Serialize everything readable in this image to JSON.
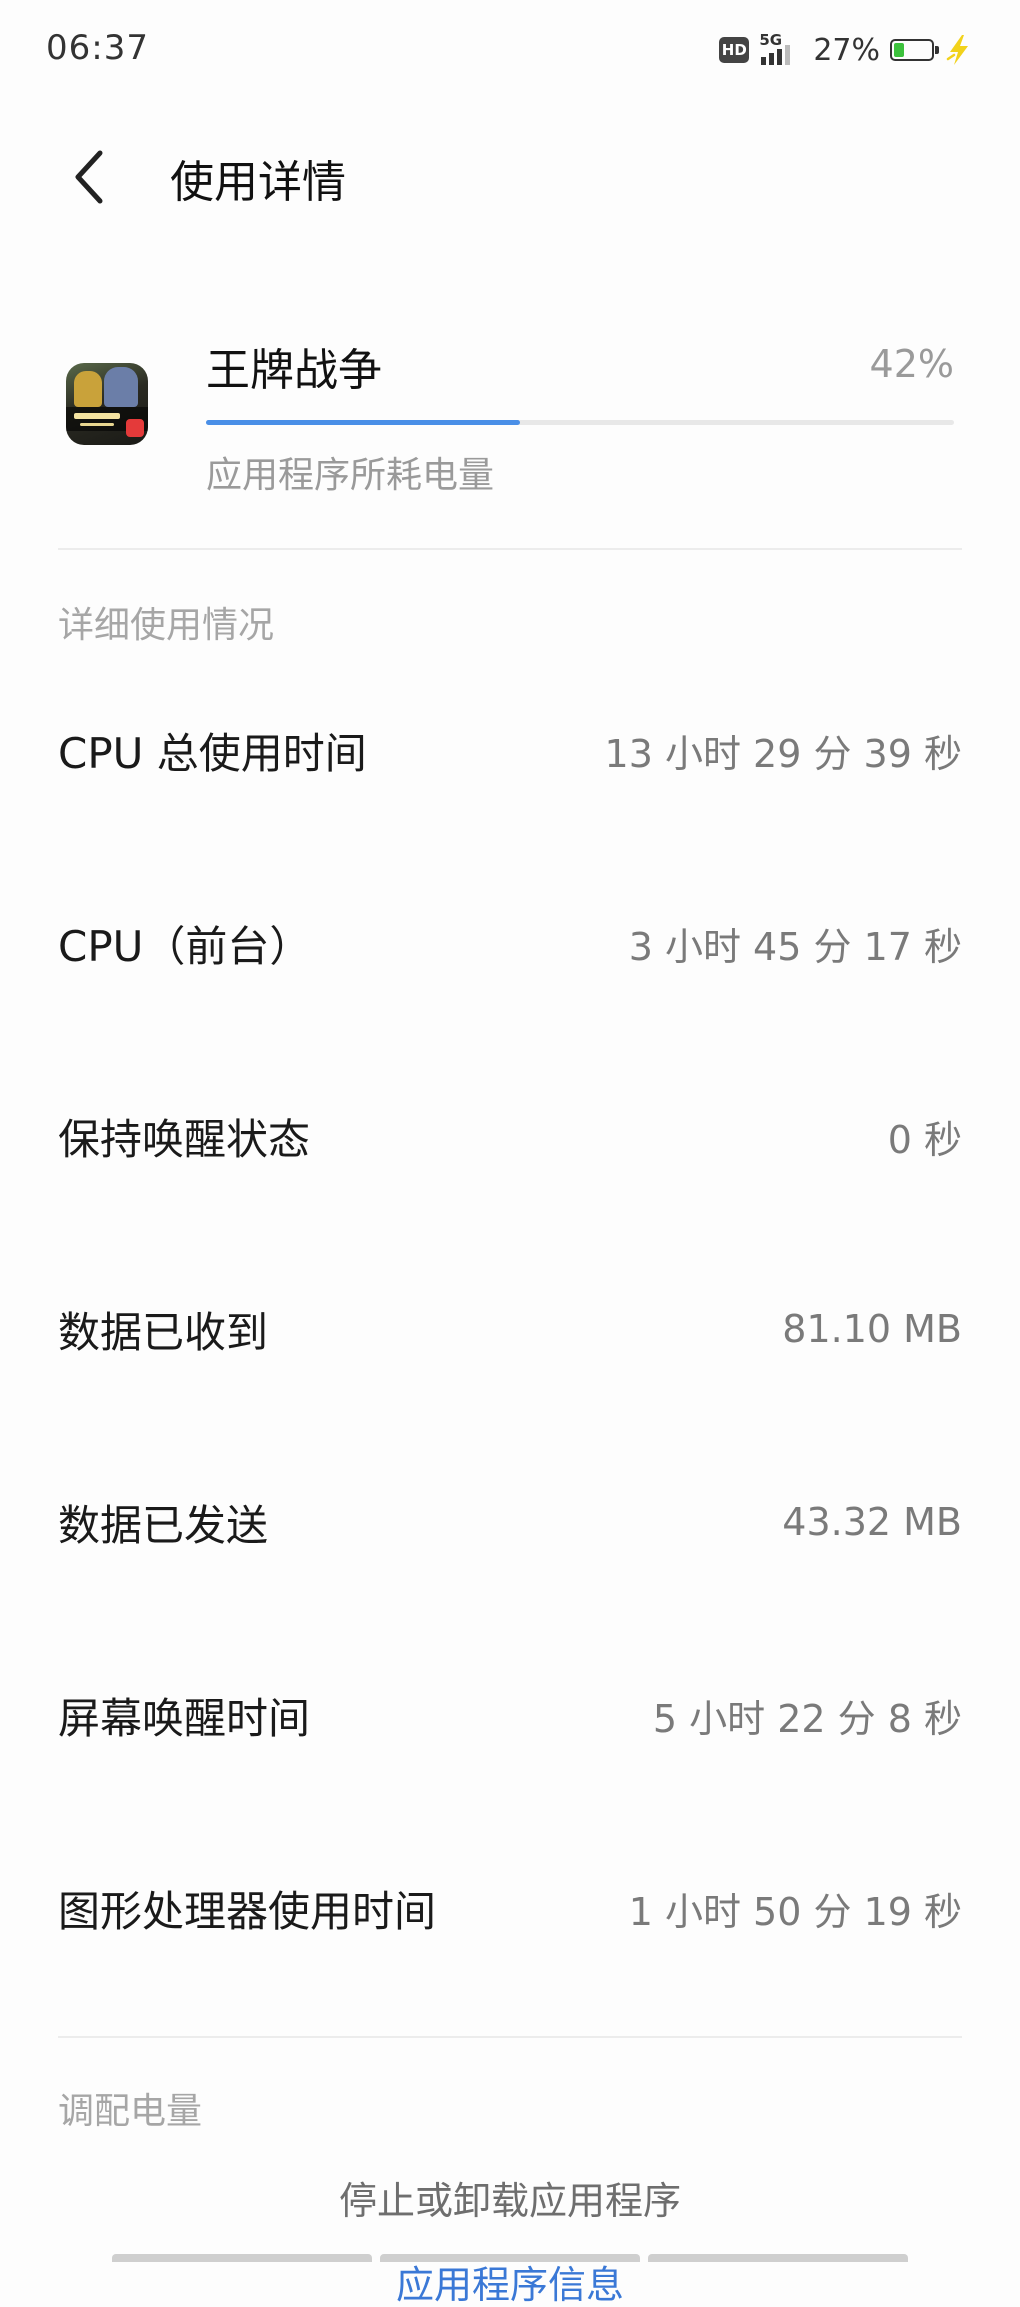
{
  "status_bar": {
    "time": "06:37",
    "network_type": "5G",
    "battery_percent_text": "27%",
    "battery_level": 0.27,
    "icons": [
      "hd-icon",
      "signal-icon",
      "battery-icon",
      "charging-icon"
    ]
  },
  "header": {
    "back_icon": "chevron-left-icon",
    "title": "使用详情"
  },
  "app": {
    "name": "王牌战争",
    "usage_percent_text": "42%",
    "usage_fraction": 0.42,
    "subtitle": "应用程序所耗电量",
    "progress_color": "#4a8fe7"
  },
  "details": {
    "section_title": "详细使用情况",
    "rows": [
      {
        "label": "CPU 总使用时间",
        "value": "13 小时 29 分 39 秒"
      },
      {
        "label": "CPU（前台）",
        "value": "3 小时 45 分 17 秒"
      },
      {
        "label": "保持唤醒状态",
        "value": "0 秒"
      },
      {
        "label": "数据已收到",
        "value": "81.10 MB"
      },
      {
        "label": "数据已发送",
        "value": "43.32 MB"
      },
      {
        "label": "屏幕唤醒时间",
        "value": "5 小时 22 分 8 秒"
      },
      {
        "label": "图形处理器使用时间",
        "value": "1 小时 50 分 19 秒"
      }
    ]
  },
  "power": {
    "section_title": "调配电量",
    "action_label": "停止或卸载应用程序",
    "bottom_button_label": "应用程序信息"
  },
  "colors": {
    "accent": "#4a8fe7",
    "battery_green": "#3cc13c",
    "charge_yellow": "#f2d21b"
  }
}
